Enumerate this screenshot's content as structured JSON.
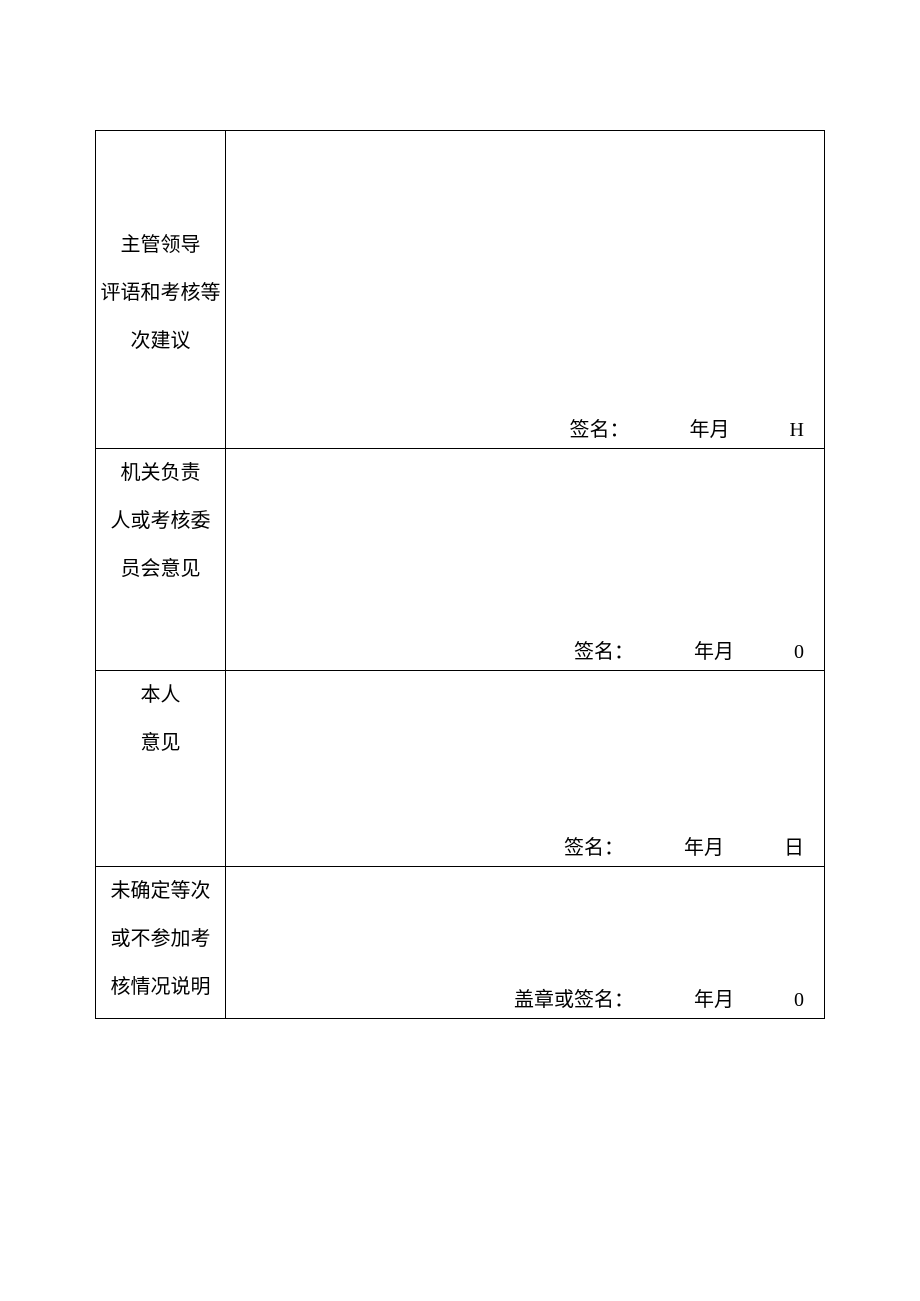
{
  "rows": [
    {
      "label_line1": "主管领导",
      "label_line2": "评语和考核等",
      "label_line3": "次建议",
      "sig_label": "签名：",
      "date_ym": "年月",
      "day_label": "H"
    },
    {
      "label_line1": "机关负责",
      "label_line2": "人或考核委",
      "label_line3": "员会意见",
      "sig_label": "签名：",
      "date_ym": "年月",
      "day_label": "0"
    },
    {
      "label_line1": "本人",
      "label_line2": "意见",
      "sig_label": "签名：",
      "date_ym": "年月",
      "day_label": "日"
    },
    {
      "label_line1": "未确定等次",
      "label_line2": "或不参加考",
      "label_line3": "核情况说明",
      "sig_label": "盖章或签名：",
      "date_ym": "年月",
      "day_label": "0"
    }
  ]
}
